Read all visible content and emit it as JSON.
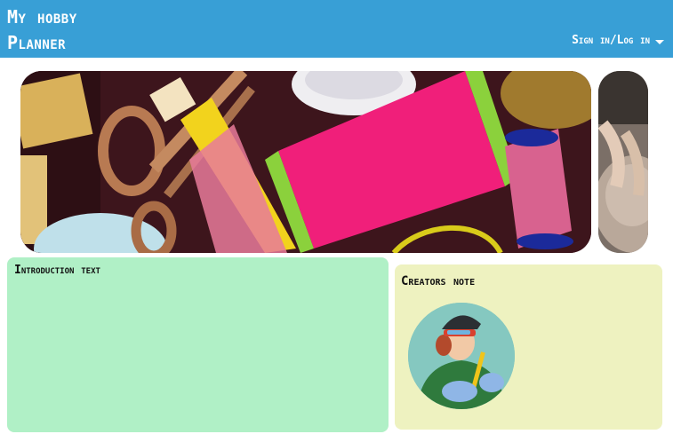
{
  "header": {
    "title_line1": "My hobby",
    "title_line2": "Planner",
    "signin_label": "Sign in/Log in",
    "background": "#389fd6"
  },
  "carousel": {
    "slides": [
      {
        "subject": "sewing supplies: scissors, pink thread spools, measuring tape"
      },
      {
        "subject": "pottery wheel with hands shaping clay"
      }
    ]
  },
  "intro": {
    "title": "Introduction text",
    "background": "#b0f0c6"
  },
  "creators_note": {
    "title": "Creators note",
    "background": "#eef2c0"
  },
  "icons": {
    "caret": "chevron-down-icon"
  }
}
